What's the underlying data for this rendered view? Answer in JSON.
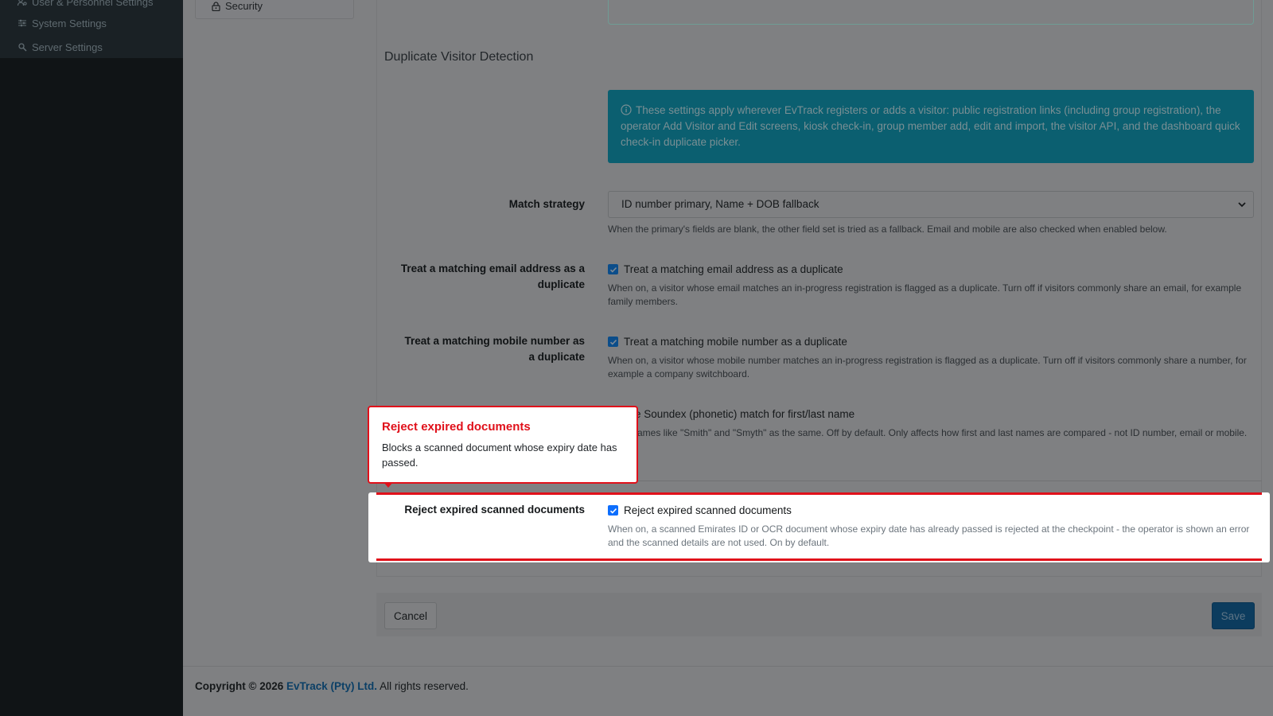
{
  "sidebar": {
    "items": [
      {
        "label": "User & Personnel Settings",
        "icon": "users-cog-icon"
      },
      {
        "label": "System Settings",
        "icon": "sliders-icon"
      },
      {
        "label": "Server Settings",
        "icon": "server-cog-icon"
      }
    ]
  },
  "settings_nav": {
    "security_label": "Security",
    "security_icon": "lock-icon"
  },
  "section": {
    "title": "Duplicate Visitor Detection",
    "info_icon": "info-circle-icon",
    "info": "These settings apply wherever EvTrack registers or adds a visitor: public registration links (including group registration), the operator Add Visitor and Edit screens, kiosk check-in, group member add, edit and import, the visitor API, and the dashboard quick check-in duplicate picker."
  },
  "fields": {
    "match_strategy": {
      "label": "Match strategy",
      "value": "ID number primary, Name + DOB fallback",
      "help": "When the primary's fields are blank, the other field set is tried as a fallback. Email and mobile are also checked when enabled below."
    },
    "email": {
      "label": "Treat a matching email address as a duplicate",
      "checkbox_label": "Treat a matching email address as a duplicate",
      "checked": true,
      "help": "When on, a visitor whose email matches an in-progress registration is flagged as a duplicate. Turn off if visitors commonly share an email, for example family members."
    },
    "mobile": {
      "label": "Treat a matching mobile number as a duplicate",
      "checkbox_label": "Treat a matching mobile number as a duplicate",
      "checked": true,
      "help": "When on, a visitor whose mobile number matches an in-progress registration is flagged as a duplicate. Turn off if visitors commonly share a number, for example a company switchboard."
    },
    "soundex": {
      "checkbox_label_visible": "e Soundex (phonetic) match for first/last name",
      "help_visible": "ames like \"Smith\" and \"Smyth\" as the same. Off by default. Only affects how first and last names are compared - not ID number, email or mobile."
    },
    "reject_expired": {
      "label": "Reject expired scanned documents",
      "checkbox_label": "Reject expired scanned documents",
      "checked": true,
      "help": "When on, a scanned Emirates ID or OCR document whose expiry date has already passed is rejected at the checkpoint - the operator is shown an error and the scanned details are not used. On by default."
    }
  },
  "callout": {
    "title": "Reject expired documents",
    "body": "Blocks a scanned document whose expiry date has passed."
  },
  "buttons": {
    "cancel": "Cancel",
    "save": "Save"
  },
  "footer": {
    "prefix": "Copyright © 2026",
    "brand": "EvTrack (Pty) Ltd.",
    "suffix": "All rights reserved."
  },
  "colors": {
    "accent_red": "#e0101a",
    "checkbox_blue": "#0d6efd",
    "info_teal": "#0dcaf0",
    "brand_blue": "#0d6efd"
  }
}
